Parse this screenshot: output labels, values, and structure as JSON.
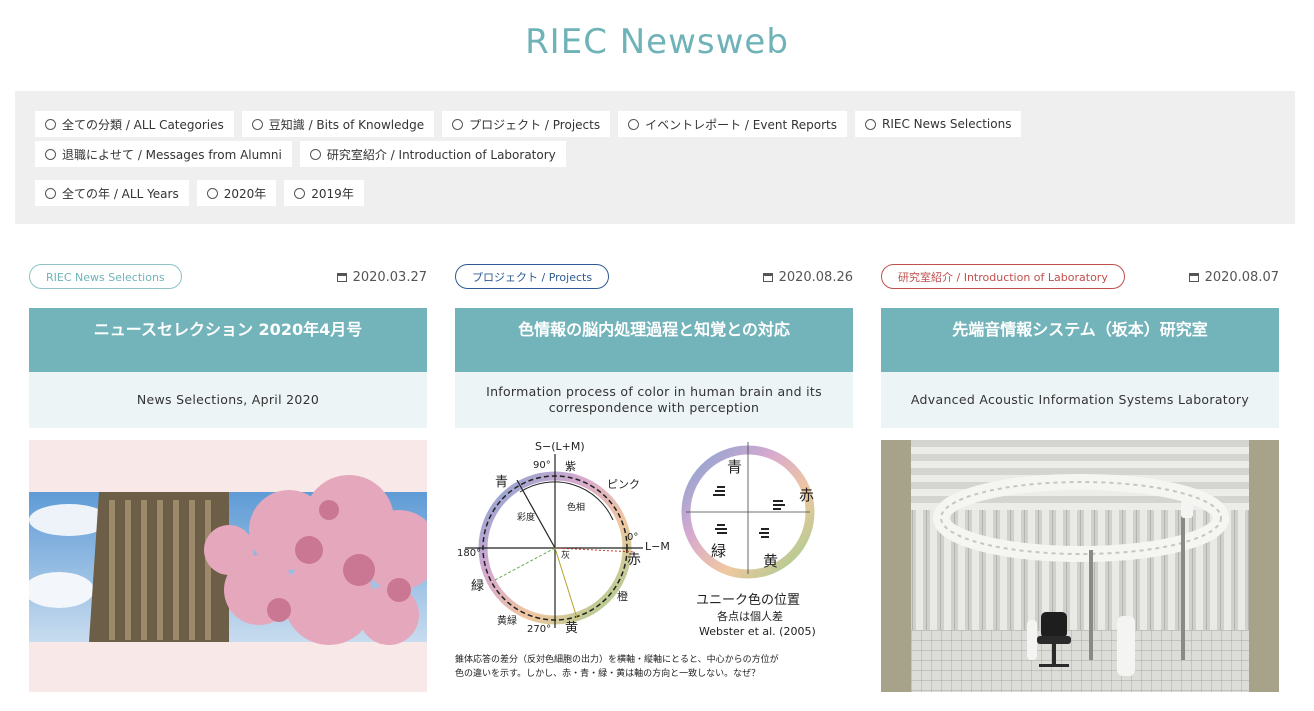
{
  "site": {
    "title": "RIEC Newsweb"
  },
  "filters": {
    "categories": [
      "全ての分類 / ALL Categories",
      "豆知識 / Bits of Knowledge",
      "プロジェクト / Projects",
      "イベントレポート / Event Reports",
      "RIEC News Selections",
      "退職によせて / Messages from Alumni",
      "研究室紹介 / Introduction of Laboratory"
    ],
    "years": [
      "全ての年 / ALL Years",
      "2020年",
      "2019年"
    ]
  },
  "cards": [
    {
      "tag": "RIEC News Selections",
      "date": "2020.03.27",
      "title_ja": "ニュースセレクション 2020年4月号",
      "title_en": "News Selections, April 2020",
      "tag_color": "#6fb3b8"
    },
    {
      "tag": "プロジェクト / Projects",
      "date": "2020.08.26",
      "title_ja": "色情報の脳内処理過程と知覚との対応",
      "title_en": "Information process of color in human brain and its correspondence with perception",
      "tag_color": "#2e5a93",
      "figure": {
        "axis_top": "S−(L+M)",
        "axis_right": "L−M",
        "angle_90": "90°",
        "angle_0": "0°",
        "angle_180": "180°",
        "angle_270": "270°",
        "label_murasaki": "紫",
        "label_pink": "ピンク",
        "label_ao": "青",
        "label_aka": "赤",
        "label_midori": "緑",
        "label_kiiro": "黄",
        "label_daidai": "橙",
        "label_kimidori": "黄緑",
        "label_shikiso": "色相",
        "label_saido": "彩度",
        "label_hai": "灰",
        "unique_title": "ユニーク色の位置",
        "unique_sub": "各点は個人差",
        "citation": "Webster et al. (2005)",
        "caption_line1": "錐体応答の差分（反対色細胞の出力）を横軸・縦軸にとると、中心からの方位が",
        "caption_line2": "色の違いを示す。しかし、赤・青・緑・黄は軸の方向と一致しない。なぜ？"
      }
    },
    {
      "tag": "研究室紹介 / Introduction of Laboratory",
      "date": "2020.08.07",
      "title_ja": "先端音情報システム（坂本）研究室",
      "title_en": "Advanced Acoustic Information Systems Laboratory",
      "tag_color": "#c0504d"
    }
  ]
}
